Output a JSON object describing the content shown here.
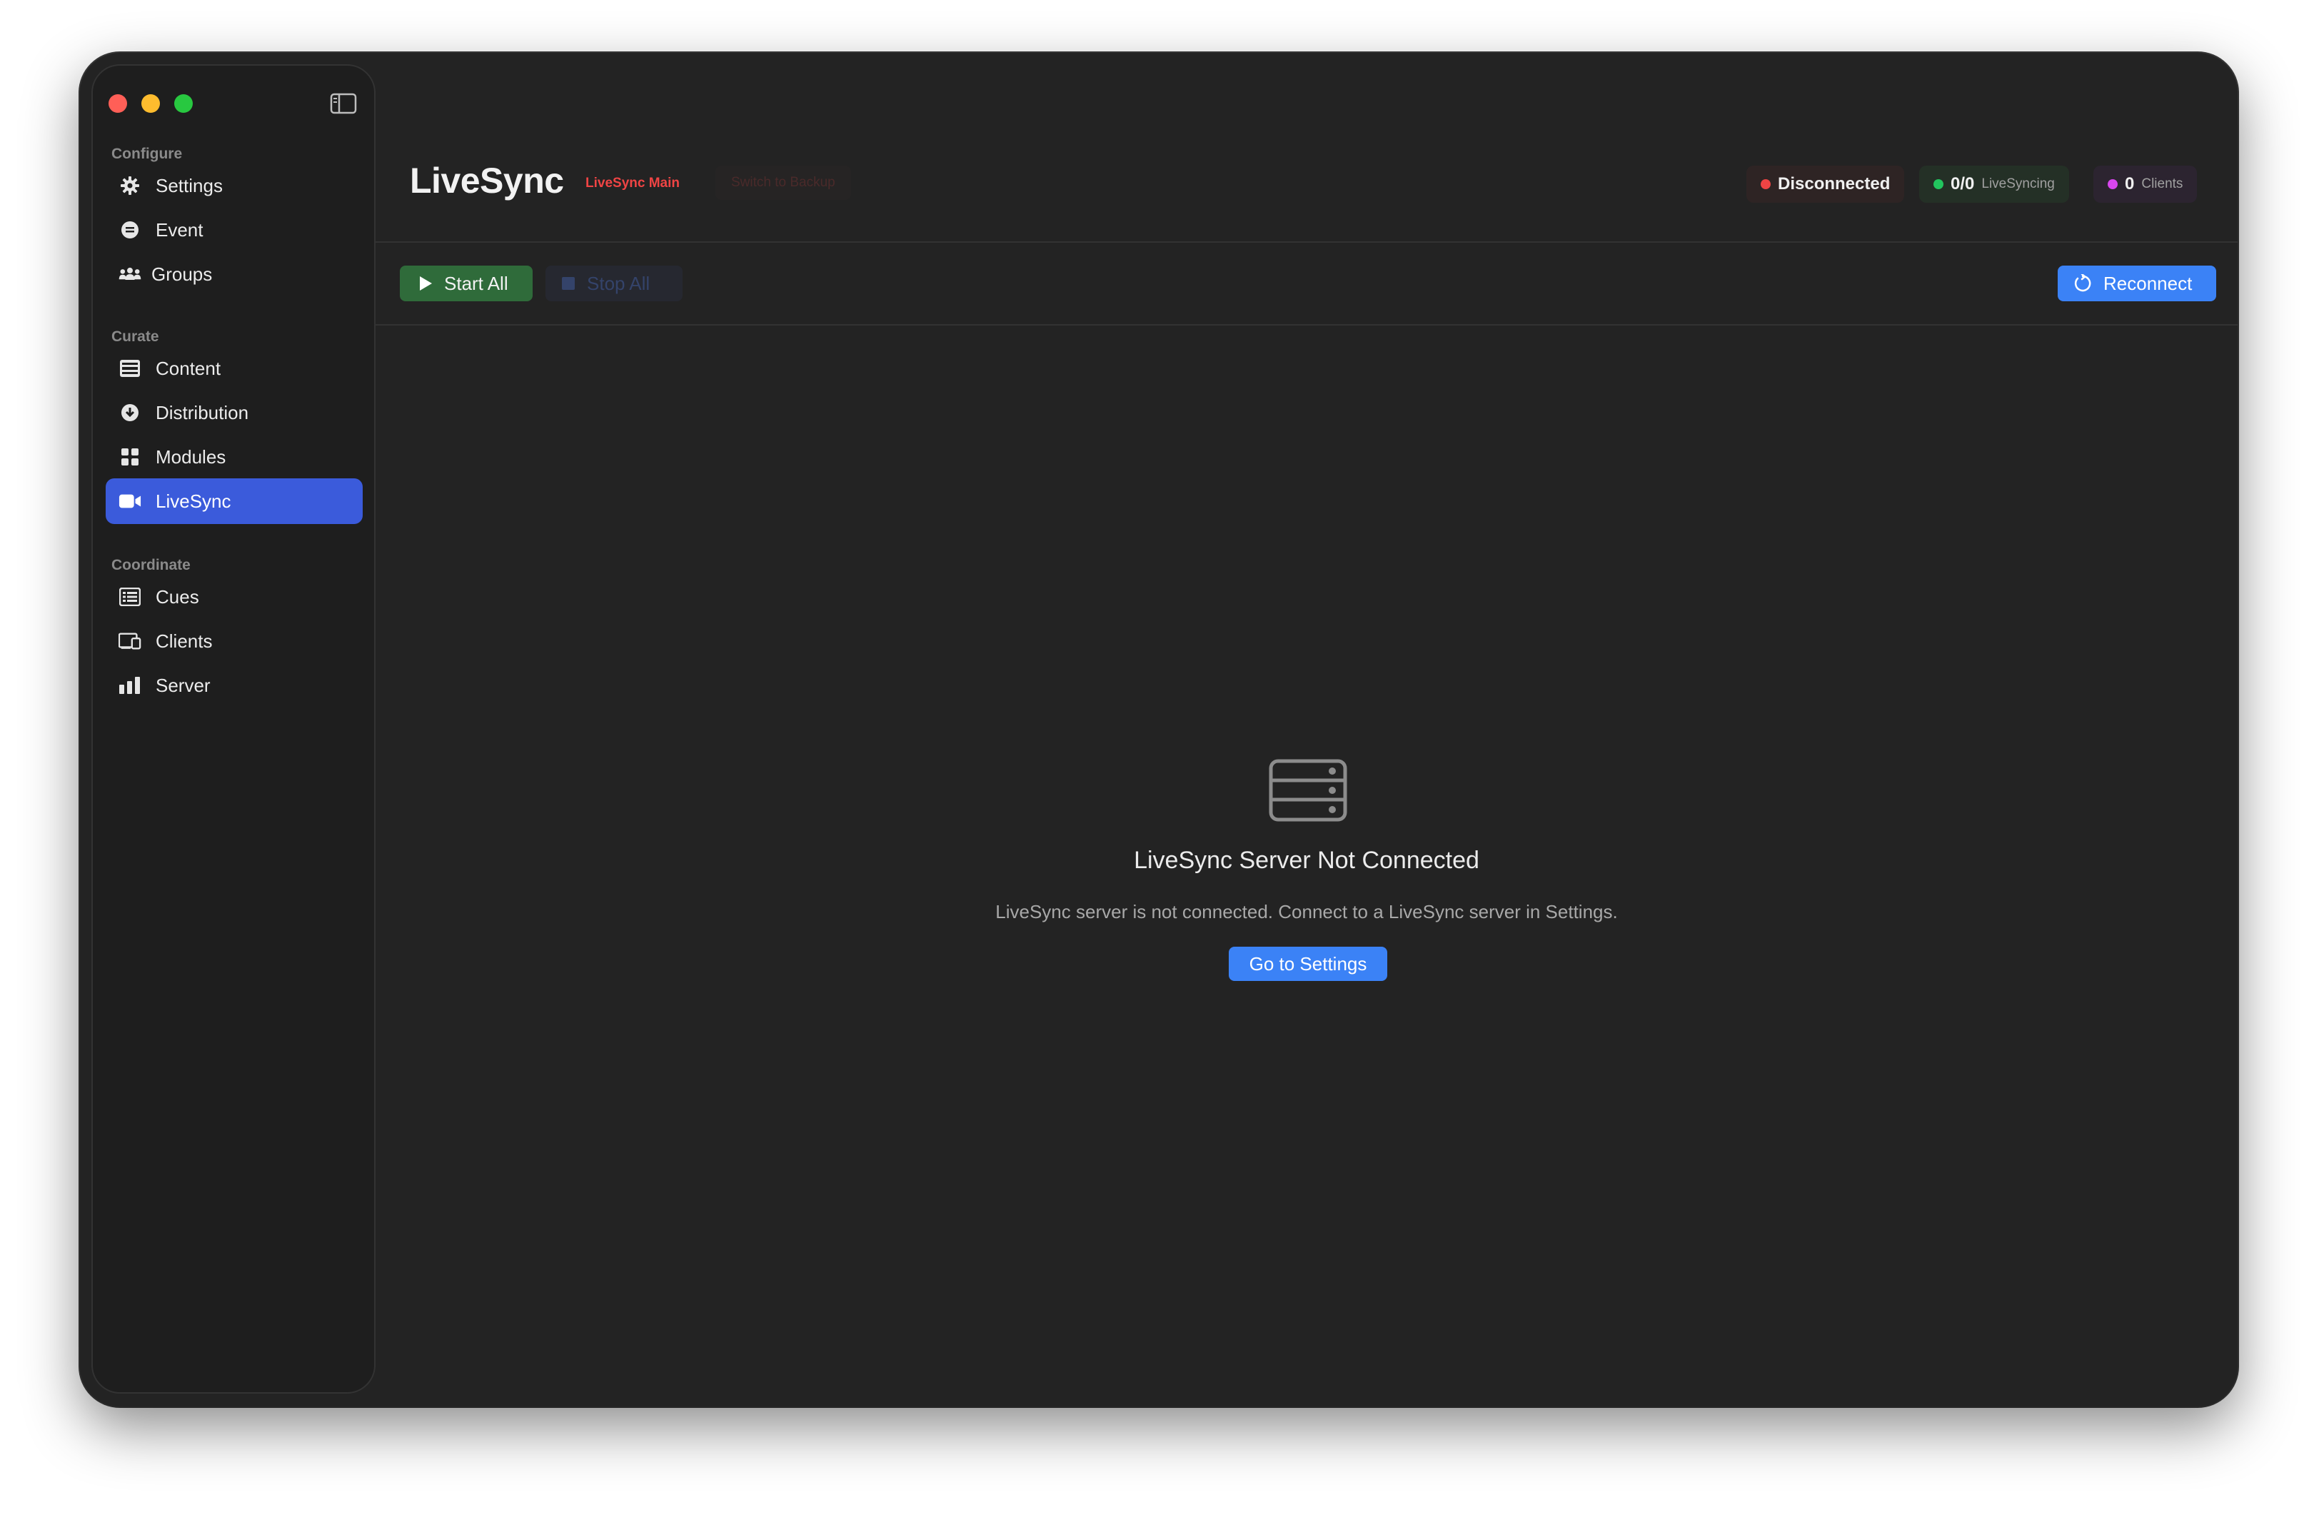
{
  "sidebar": {
    "sections": [
      {
        "label": "Configure"
      },
      {
        "label": "Curate"
      },
      {
        "label": "Coordinate"
      }
    ],
    "items": [
      {
        "label": "Settings",
        "icon": "gear-icon"
      },
      {
        "label": "Event",
        "icon": "calendar-icon"
      },
      {
        "label": "Groups",
        "icon": "people-icon"
      },
      {
        "label": "Content",
        "icon": "film-icon"
      },
      {
        "label": "Distribution",
        "icon": "download-circle-icon"
      },
      {
        "label": "Modules",
        "icon": "grid-icon"
      },
      {
        "label": "LiveSync",
        "icon": "video-camera-icon",
        "active": true
      },
      {
        "label": "Cues",
        "icon": "list-icon"
      },
      {
        "label": "Clients",
        "icon": "devices-icon"
      },
      {
        "label": "Server",
        "icon": "bar-chart-icon"
      }
    ]
  },
  "header": {
    "title": "LiveSync",
    "main_tag": "LiveSync Main",
    "backup_button": "Switch to Backup",
    "status": {
      "connection": "Disconnected",
      "livesync_count": "0/0",
      "livesync_label": "LiveSyncing",
      "clients_count": "0",
      "clients_label": "Clients"
    }
  },
  "toolbar": {
    "start_all": "Start All",
    "stop_all": "Stop All",
    "reconnect": "Reconnect"
  },
  "empty_state": {
    "icon": "server-rack-icon",
    "title": "LiveSync Server Not Connected",
    "description": "LiveSync server is not connected. Connect to a LiveSync server in Settings.",
    "button": "Go to Settings"
  },
  "colors": {
    "accent": "#3b5bdb",
    "button_blue": "#3b82f6",
    "start_green": "#2f6b3a",
    "status_red": "#ef4444",
    "status_green": "#22c55e",
    "status_magenta": "#d946ef"
  }
}
